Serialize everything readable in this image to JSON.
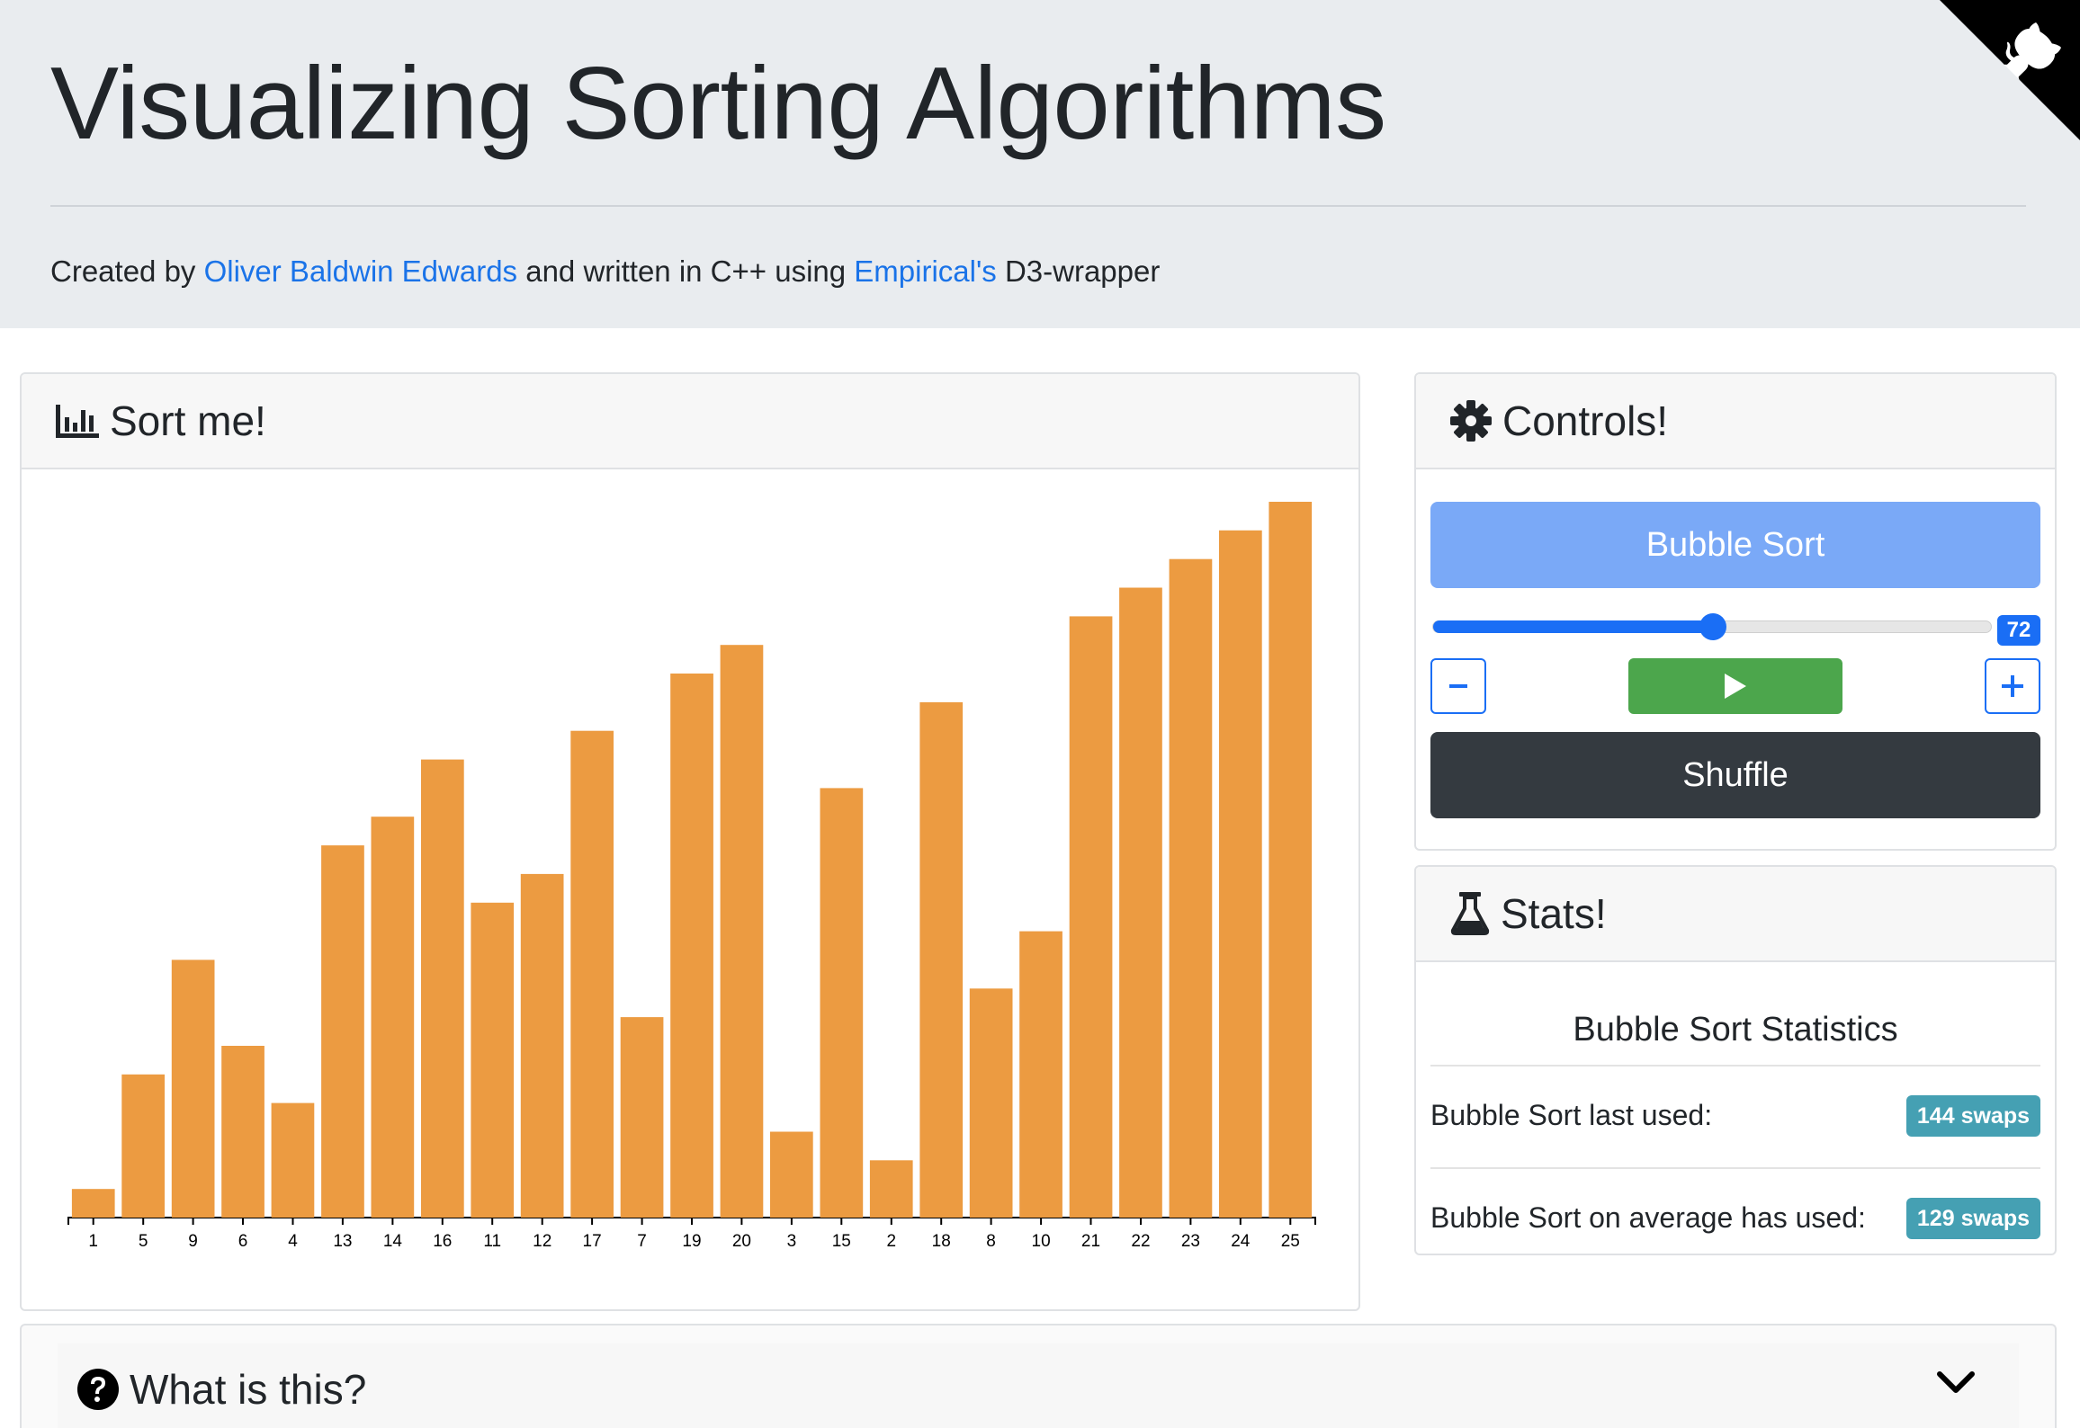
{
  "header": {
    "title": "Visualizing Sorting Algorithms",
    "byline_prefix": "Created by ",
    "author_link": "Oliver Baldwin Edwards",
    "byline_middle": " and written in C++ using ",
    "library_link": "Empirical's",
    "byline_suffix": " D3-wrapper",
    "github_icon": "github-octocat-icon"
  },
  "sort_card": {
    "title": "Sort me!",
    "icon": "bar-chart-icon"
  },
  "controls_card": {
    "title": "Controls!",
    "icon": "gear-icon",
    "algorithm_button": "Bubble Sort",
    "speed_value": "72",
    "speed_fraction": 0.5,
    "decrease_icon": "minus-icon",
    "play_icon": "play-icon",
    "increase_icon": "plus-icon",
    "shuffle_button": "Shuffle"
  },
  "stats_card": {
    "title": "Stats!",
    "icon": "flask-icon",
    "heading": "Bubble Sort Statistics",
    "rows": [
      {
        "label": "Bubble Sort last used:",
        "badge": "144 swaps"
      },
      {
        "label": "Bubble Sort on average has used:",
        "badge": "129 swaps"
      }
    ]
  },
  "about_card": {
    "title": "What is this?",
    "icon": "question-circle-icon",
    "toggle_icon": "chevron-down-icon"
  },
  "colors": {
    "bar": "#ec9b41",
    "primary": "#1a6ef5",
    "success": "#4ca64c",
    "dark": "#343a40",
    "info": "#45a0b3",
    "link": "#1a73e8"
  },
  "chart_data": {
    "type": "bar",
    "categories": [
      "1",
      "5",
      "9",
      "6",
      "4",
      "13",
      "14",
      "16",
      "11",
      "12",
      "17",
      "7",
      "19",
      "20",
      "3",
      "15",
      "2",
      "18",
      "8",
      "10",
      "21",
      "22",
      "23",
      "24",
      "25"
    ],
    "values": [
      1,
      5,
      9,
      6,
      4,
      13,
      14,
      16,
      11,
      12,
      17,
      7,
      19,
      20,
      3,
      15,
      2,
      18,
      8,
      10,
      21,
      22,
      23,
      24,
      25
    ],
    "ylim": [
      0,
      25
    ],
    "grid": false
  }
}
